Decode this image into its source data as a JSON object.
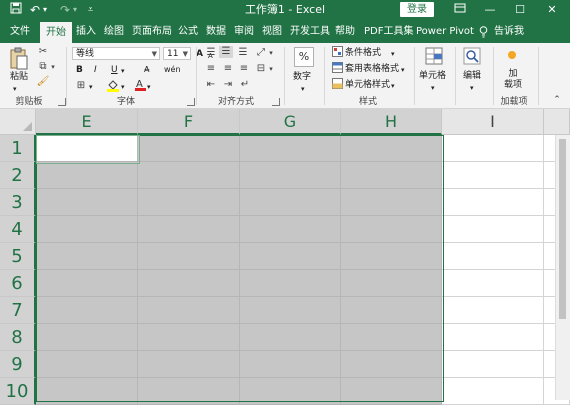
{
  "titlebar": {
    "title": "工作簿1 - Excel",
    "login_label": "登录",
    "save_icon": "save-icon",
    "undo_icon": "undo-icon",
    "redo_icon": "redo-icon",
    "qat_more_icon": "chevron-down-icon",
    "ribbon_options_icon": "ribbon-display-icon",
    "minimize_glyph": "—",
    "maximize_glyph": "☐",
    "close_glyph": "✕"
  },
  "tabs": [
    {
      "label": "文件"
    },
    {
      "label": "开始"
    },
    {
      "label": "插入"
    },
    {
      "label": "绘图"
    },
    {
      "label": "页面布局"
    },
    {
      "label": "公式"
    },
    {
      "label": "数据"
    },
    {
      "label": "审阅"
    },
    {
      "label": "视图"
    },
    {
      "label": "开发工具"
    },
    {
      "label": "帮助"
    },
    {
      "label": "PDF工具集"
    },
    {
      "label": "Power Pivot"
    },
    {
      "label": "告诉我"
    }
  ],
  "active_tab": "开始",
  "ribbon": {
    "clipboard": {
      "paste_label": "粘贴",
      "group_label": "剪贴板"
    },
    "font": {
      "font_name": "等线",
      "font_size": "11",
      "group_label": "字体",
      "bold": "B",
      "italic": "I",
      "underline": "U",
      "grow": "A",
      "shrink": "A",
      "phonetic": "wén"
    },
    "alignment": {
      "group_label": "对齐方式"
    },
    "number": {
      "label": "数字",
      "format_icon": "%"
    },
    "styles": {
      "items": [
        "条件格式",
        "套用表格格式",
        "单元格样式"
      ],
      "group_label": "样式"
    },
    "cells": {
      "label": "单元格"
    },
    "editing": {
      "label": "编辑"
    },
    "addins": {
      "label": "加\n载项",
      "group_label": "加载项"
    }
  },
  "grid": {
    "columns": [
      "E",
      "F",
      "G",
      "H",
      "I"
    ],
    "rows": [
      "1",
      "2",
      "3",
      "4",
      "5",
      "6",
      "7",
      "8",
      "9",
      "10"
    ],
    "selected_columns": [
      "E",
      "F",
      "G",
      "H"
    ],
    "active_cell": "E1"
  },
  "colors": {
    "accent": "#217346",
    "selection_fill": "#c6c6c6"
  }
}
